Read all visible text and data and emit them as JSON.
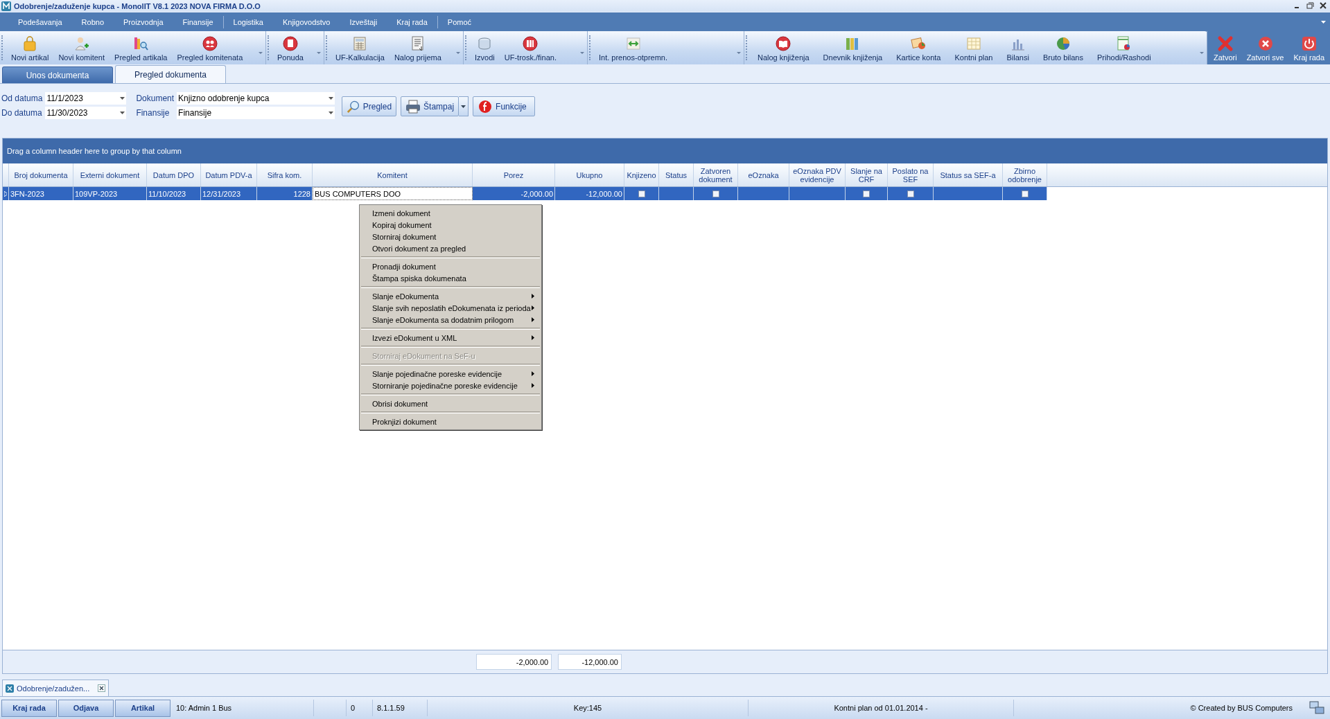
{
  "window": {
    "title": "Odobrenje/zaduženje kupca - MonolIT V8.1 2023 NOVA FIRMA D.O.O"
  },
  "menu": [
    {
      "label": "Podešavanja",
      "group_end": false
    },
    {
      "label": "Robno",
      "group_end": false
    },
    {
      "label": "Proizvodnja",
      "group_end": false
    },
    {
      "label": "Finansije",
      "group_end": true
    },
    {
      "label": "Logistika",
      "group_end": false
    },
    {
      "label": "Knjigovodstvo",
      "group_end": false
    },
    {
      "label": "Izveštaji",
      "group_end": false
    },
    {
      "label": "Kraj rada",
      "group_end": true
    },
    {
      "label": "Pomoć",
      "group_end": false
    }
  ],
  "toolbar": {
    "groups": [
      {
        "items": [
          "Novi artikal",
          "Novi komitent",
          "Pregled artikala",
          "Pregled komitenata"
        ]
      },
      {
        "items": [
          "Ponuda"
        ]
      },
      {
        "items": [
          "UF-Kalkulacija",
          "Nalog prijema"
        ]
      },
      {
        "items": [
          "Izvodi",
          "UF-trosk./finan."
        ]
      },
      {
        "items": [
          "Int. prenos-otpremn."
        ]
      },
      {
        "items": [
          "Nalog knjiženja",
          "Dnevnik knjiženja",
          "Kartice konta",
          "Kontni plan",
          "Bilansi",
          "Bruto bilans",
          "Prihodi/Rashodi"
        ]
      }
    ],
    "window_buttons": [
      "Zatvori",
      "Zatvori sve",
      "Kraj rada"
    ]
  },
  "tabs": [
    {
      "label": "Unos dokumenta",
      "selected": false
    },
    {
      "label": "Pregled dokumenta",
      "selected": true
    }
  ],
  "filters": [
    {
      "label": "Od datuma",
      "value": "11/1/2023"
    },
    {
      "label": "Dokument",
      "value": "Knjizno odobrenje kupca"
    },
    {
      "label": "Do datuma",
      "value": "11/30/2023"
    },
    {
      "label": "Finansije",
      "value": "Finansije"
    }
  ],
  "actions": [
    {
      "label": "Pregled",
      "dropdown": false
    },
    {
      "label": "Štampaj",
      "dropdown": true
    },
    {
      "label": "Funkcije",
      "dropdown": false
    }
  ],
  "grid": {
    "group_panel": "Drag a column header here to group by that column",
    "columns": [
      "Broj dokumenta",
      "Externi dokument",
      "Datum DPO",
      "Datum PDV-a",
      "Sifra kom.",
      "Komitent",
      "Porez",
      "Ukupno",
      "Knjizeno",
      "Status",
      "Zatvoren dokument",
      "eOznaka",
      "eOznaka PDV evidencije",
      "Slanje na CRF",
      "Poslato na SEF",
      "Status sa SEF-a",
      "Zbirno odobrenje"
    ],
    "rows": [
      {
        "selected": true,
        "cells": [
          {
            "kind": "text",
            "text": "3FN-2023",
            "focused": false
          },
          {
            "kind": "text",
            "text": "109VP-2023",
            "focused": false
          },
          {
            "kind": "text",
            "text": "11/10/2023",
            "focused": false
          },
          {
            "kind": "text",
            "text": "12/31/2023",
            "focused": false
          },
          {
            "kind": "number",
            "text": "1228",
            "focused": false
          },
          {
            "kind": "text",
            "text": "BUS COMPUTERS DOO",
            "focused": true
          },
          {
            "kind": "number",
            "text": "-2,000.00",
            "focused": false
          },
          {
            "kind": "number",
            "text": "-12,000.00",
            "focused": false
          },
          {
            "kind": "check",
            "checked": false,
            "focused": false
          },
          {
            "kind": "empty",
            "focused": false
          },
          {
            "kind": "check",
            "checked": false,
            "focused": false
          },
          {
            "kind": "empty",
            "focused": false
          },
          {
            "kind": "empty",
            "focused": false
          },
          {
            "kind": "check",
            "checked": false,
            "focused": false
          },
          {
            "kind": "check",
            "checked": false,
            "focused": false
          },
          {
            "kind": "empty",
            "focused": false
          },
          {
            "kind": "check",
            "checked": false,
            "focused": false
          }
        ]
      }
    ],
    "footer": [
      {
        "kind": "empty"
      },
      {
        "kind": "empty"
      },
      {
        "kind": "empty"
      },
      {
        "kind": "empty"
      },
      {
        "kind": "empty"
      },
      {
        "kind": "empty"
      },
      {
        "kind": "total",
        "text": "-2,000.00"
      },
      {
        "kind": "total",
        "text": "-12,000.00"
      }
    ]
  },
  "context_menu": [
    {
      "kind": "item",
      "label": "Izmeni dokument",
      "disabled": false,
      "submenu": false
    },
    {
      "kind": "item",
      "label": "Kopiraj dokument",
      "disabled": false,
      "submenu": false
    },
    {
      "kind": "item",
      "label": "Storniraj dokument",
      "disabled": false,
      "submenu": false
    },
    {
      "kind": "item",
      "label": "Otvori dokument za pregled",
      "disabled": false,
      "submenu": false
    },
    {
      "kind": "separator"
    },
    {
      "kind": "item",
      "label": "Pronadji dokument",
      "disabled": false,
      "submenu": false
    },
    {
      "kind": "item",
      "label": "Štampa spiska dokumenata",
      "disabled": false,
      "submenu": false
    },
    {
      "kind": "separator"
    },
    {
      "kind": "item",
      "label": "Slanje eDokumenta",
      "disabled": false,
      "submenu": true
    },
    {
      "kind": "item",
      "label": "Slanje svih neposlatih eDokumenata iz perioda",
      "disabled": false,
      "submenu": true
    },
    {
      "kind": "item",
      "label": "Slanje eDokumenta sa dodatnim prilogom",
      "disabled": false,
      "submenu": true
    },
    {
      "kind": "separator"
    },
    {
      "kind": "item",
      "label": "Izvezi eDokument u XML",
      "disabled": false,
      "submenu": true
    },
    {
      "kind": "separator"
    },
    {
      "kind": "item",
      "label": "Storniraj eDokument na SeF-u",
      "disabled": true,
      "submenu": false
    },
    {
      "kind": "separator"
    },
    {
      "kind": "item",
      "label": "Slanje pojedinačne poreske evidencije",
      "disabled": false,
      "submenu": true
    },
    {
      "kind": "item",
      "label": "Storniranje pojedinačne poreske evidencije",
      "disabled": false,
      "submenu": true
    },
    {
      "kind": "separator"
    },
    {
      "kind": "item",
      "label": "Obrisi dokument",
      "disabled": false,
      "submenu": false
    },
    {
      "kind": "separator"
    },
    {
      "kind": "item",
      "label": "Proknjizi dokument",
      "disabled": false,
      "submenu": false
    }
  ],
  "doc_tabs": [
    {
      "label": "Odobrenje/zadužen...",
      "selected": true
    }
  ],
  "status_bar": {
    "buttons": [
      "Kraj rada",
      "Odjava",
      "Artikal"
    ],
    "panels": [
      {
        "kind": "user",
        "text": "10: Admin 1 Bus"
      },
      {
        "kind": "blank"
      },
      {
        "kind": "count",
        "text": "0"
      },
      {
        "kind": "version",
        "text": "8.1.1.59"
      },
      {
        "kind": "key",
        "text": "Key:145"
      },
      {
        "kind": "plan",
        "text": "Kontni plan od 01.01.2014 -"
      },
      {
        "kind": "credit",
        "text": "© Created by BUS Computers"
      }
    ]
  }
}
